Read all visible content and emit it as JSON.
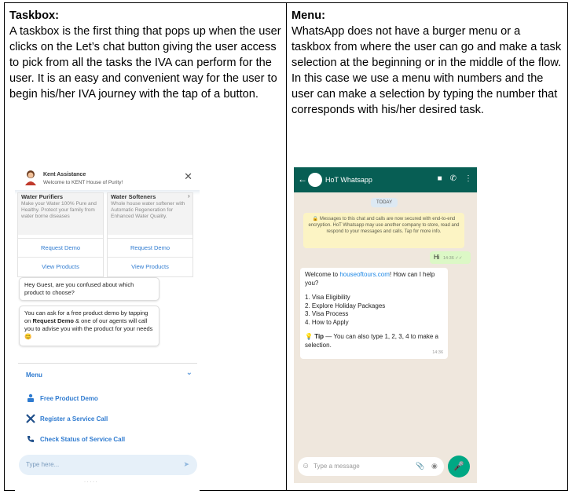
{
  "left": {
    "heading": "Taskbox:",
    "body": "A taskbox is the first thing that pops up when the user clicks on the Let’s chat button giving the user access to pick from all the tasks the IVA can perform for the user. It is an easy and convenient way for the user to begin his/her IVA journey with the tap of a button.",
    "mock": {
      "agent_name": "Kent Assistance",
      "welcome": "Welcome to KENT House of Purity!",
      "close_icon": "close-icon",
      "cards": [
        {
          "title": "Water Purifiers",
          "desc": "Make your Water 100% Pure and Healthy. Protect your family from water borne diseases",
          "cta1": "Request Demo",
          "cta2": "View Products"
        },
        {
          "title": "Water Softeners",
          "desc": "Whole house water softener with Automatic Regeneration for Enhanced Water Quality.",
          "cta1": "Request Demo",
          "cta2": "View Products"
        }
      ],
      "bubble1": "Hey Guest, are you confused about which product to choose?",
      "bubble2_pre": "You can ask for a free product demo by tapping on ",
      "bubble2_bold": "Request Demo",
      "bubble2_post": " & one of our agents will call you to advise you with the product for your needs 😊",
      "menu_label": "Menu",
      "menu_items": [
        "Free Product Demo",
        "Register a Service Call",
        "Check Status of Service Call"
      ],
      "input_placeholder": "Type here...",
      "accent": "#2f7bd0"
    }
  },
  "right": {
    "heading": "Menu:",
    "body": "WhatsApp does not have a burger menu or a taskbox from where the user can go and make a task selection at the beginning or in the middle of the flow. In this case we use a menu with numbers and the user can make a selection by typing the number that corresponds with his/her desired task.",
    "mock": {
      "contact": "HoT Whatsapp",
      "date": "TODAY",
      "encryption": "🔒 Messages to this chat and calls are now secured with end-to-end encryption. HoT Whatsapp may use another company to store, read and respond to your messages and calls. Tap for more info.",
      "out_text": "Hi",
      "out_time": "14:36 ✓✓",
      "in_greeting_pre": "Welcome to ",
      "in_link": "houseoftours.com",
      "in_greeting_post": "! How can I help you?",
      "options": [
        "1. Visa Eligibility",
        "2. Explore Holiday Packages",
        "3. Visa Process",
        "4. How to Apply"
      ],
      "tip_bold": "Tip",
      "tip_text": " — You can also type 1, 2, 3, 4 to make a selection.",
      "in_time": "14:36",
      "input_placeholder": "Type a message",
      "header_color": "#075e54",
      "mic_color": "#00a884"
    }
  }
}
